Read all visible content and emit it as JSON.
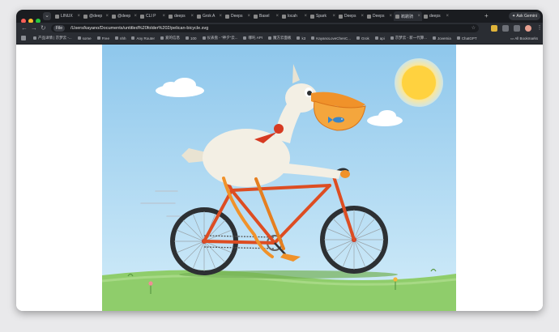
{
  "browser": {
    "tabs": [
      {
        "label": "LINUX",
        "active": false
      },
      {
        "label": "@deep",
        "active": false
      },
      {
        "label": "@deep",
        "active": false
      },
      {
        "label": "CLI P",
        "active": false
      },
      {
        "label": "deeps",
        "active": false
      },
      {
        "label": "Grok A",
        "active": false
      },
      {
        "label": "Deeps",
        "active": false
      },
      {
        "label": "Basel",
        "active": false
      },
      {
        "label": "locah",
        "active": false
      },
      {
        "label": "Spark",
        "active": false
      },
      {
        "label": "Deeps",
        "active": false
      },
      {
        "label": "Deeps",
        "active": false
      },
      {
        "label": "鹈鹕骑",
        "active": true
      },
      {
        "label": "deeps",
        "active": false
      }
    ],
    "ask_gemini": "Ask Gemini",
    "file_chip": "File",
    "url": "/Users/kayano/Documents/untitled%20folder%202/pelican-bicycle.svg",
    "bookmarks": [
      "产品详情 | 京梦云 -...",
      "some",
      "Free",
      "nhh",
      "Any Router",
      "爱的信息",
      "100",
      "仪表盘 - \"神夕\"云...",
      "哪吒 API",
      "魔方云面板",
      "k3",
      "KayanoLoveChenC...",
      "Grok",
      "api",
      "京梦云 - 新一代算...",
      "Jovemia",
      "ChatGPT"
    ],
    "all_bookmarks": "All Bookmarks"
  },
  "colors": {
    "sky_top": "#8ec7ec",
    "sky_bottom": "#d2ecf9",
    "grass": "#8fcd6b",
    "frame": "#dd4d22",
    "beak": "#f0922a",
    "body": "#f3efe4",
    "sun": "#ffd23f"
  },
  "icons": [
    "back-arrow-icon",
    "forward-arrow-icon",
    "reload-icon",
    "star-icon",
    "extension-icon",
    "profile-avatar-icon",
    "kebab-menu-icon",
    "grid-apps-icon",
    "folder-icon",
    "fish-icon"
  ]
}
